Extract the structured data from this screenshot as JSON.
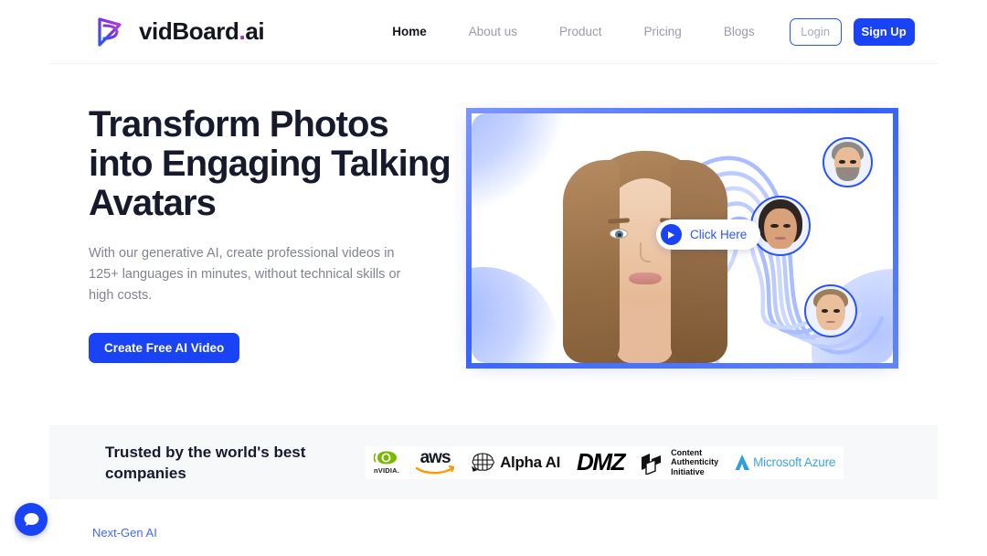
{
  "brand": {
    "name_main": "vidBoard",
    "dot": ".",
    "suffix": "ai",
    "icon": "play-logo-icon"
  },
  "nav": {
    "items": [
      {
        "label": "Home",
        "active": true
      },
      {
        "label": "About us",
        "active": false
      },
      {
        "label": "Product",
        "active": false
      },
      {
        "label": "Pricing",
        "active": false
      },
      {
        "label": "Blogs",
        "active": false
      }
    ],
    "login_label": "Login",
    "signup_label": "Sign Up"
  },
  "hero": {
    "title": "Transform Photos into Engaging Talking Avatars",
    "subtitle": "With our generative AI, create professional videos in 125+ languages in minutes, without technical skills or high costs.",
    "cta_label": "Create Free AI Video",
    "video": {
      "click_label": "Click Here",
      "play_icon": "play-icon",
      "avatars": [
        {
          "name": "avatar-older-man"
        },
        {
          "name": "avatar-woman"
        },
        {
          "name": "avatar-young-man"
        }
      ]
    }
  },
  "trusted": {
    "title": "Trusted by the world's best companies",
    "logos": [
      {
        "name": "nvidia-logo",
        "label": "nVIDIA."
      },
      {
        "name": "aws-logo",
        "label": "aws"
      },
      {
        "name": "alpha-ai-logo",
        "label": "Alpha AI"
      },
      {
        "name": "dmz-logo",
        "label": "DMZ"
      },
      {
        "name": "content-authenticity-initiative-logo",
        "line1": "Content",
        "line2": "Authenticity",
        "line3": "Initiative"
      },
      {
        "name": "microsoft-azure-logo",
        "label": "Microsoft Azure"
      }
    ]
  },
  "footer": {
    "nextgen_label": "Next-Gen AI"
  },
  "chat": {
    "icon": "chat-bubble-icon"
  },
  "colors": {
    "primary_blue": "#1a43f5",
    "accent_purple": "#8b2fd6",
    "text_dark": "#161a2b",
    "text_muted": "#81848f",
    "band_bg": "#f7f8fa"
  }
}
